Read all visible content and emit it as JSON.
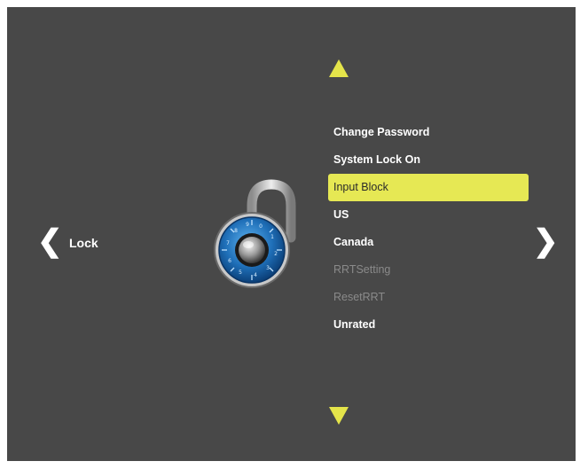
{
  "screen": {
    "section_label": "Lock",
    "prev_glyph": "❮",
    "next_glyph": "❯"
  },
  "menu": {
    "items": [
      {
        "label": "Change Password",
        "state": "enabled"
      },
      {
        "label": "System Lock On",
        "state": "enabled"
      },
      {
        "label": "Input Block",
        "state": "selected"
      },
      {
        "label": "US",
        "state": "enabled"
      },
      {
        "label": "Canada",
        "state": "enabled"
      },
      {
        "label": "RRTSetting",
        "state": "disabled"
      },
      {
        "label": "ResetRRT",
        "state": "disabled"
      },
      {
        "label": "Unrated",
        "state": "enabled"
      }
    ]
  },
  "icons": {
    "up": "triangle-up-icon",
    "down": "triangle-down-icon",
    "prev": "chevron-left-icon",
    "next": "chevron-right-icon",
    "lock": "combination-padlock-icon"
  },
  "colors": {
    "background": "#484848",
    "accent": "#e6e854",
    "text": "#ffffff",
    "disabled_text": "#8a8a8a",
    "lock_blue": "#1f6fb8"
  }
}
